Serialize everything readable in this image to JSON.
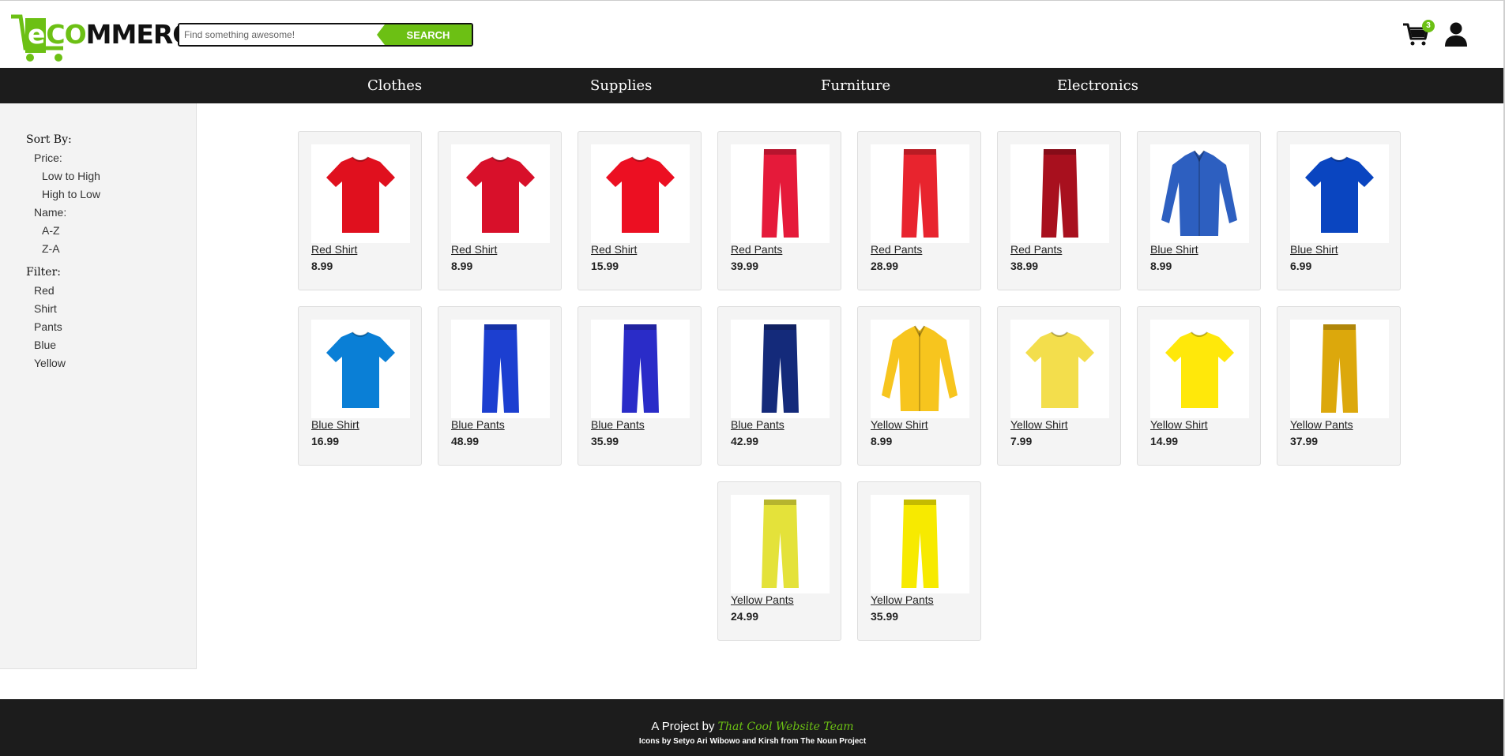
{
  "logo": {
    "part_e": "e",
    "part_co": "CO",
    "part_rest": "MMERCE"
  },
  "search": {
    "placeholder": "Find something awesome!",
    "button_label": "SEARCH"
  },
  "cart": {
    "count": "3"
  },
  "nav": {
    "items": [
      "Clothes",
      "Supplies",
      "Furniture",
      "Electronics"
    ]
  },
  "sidebar": {
    "sort_heading": "Sort By:",
    "price_label": "Price:",
    "price_low_high": "Low to High",
    "price_high_low": "High to Low",
    "name_label": "Name:",
    "name_az": "A-Z",
    "name_za": "Z-A",
    "filter_heading": "Filter:",
    "filters": [
      "Red",
      "Shirt",
      "Pants",
      "Blue",
      "Yellow"
    ]
  },
  "products": [
    {
      "name": "Red Shirt",
      "price": "8.99",
      "kind": "tshirt",
      "color": "#e0101e"
    },
    {
      "name": "Red Shirt",
      "price": "8.99",
      "kind": "tshirt",
      "color": "#d8102a"
    },
    {
      "name": "Red Shirt",
      "price": "15.99",
      "kind": "tshirt",
      "color": "#ec0f22"
    },
    {
      "name": "Red Pants",
      "price": "39.99",
      "kind": "pants",
      "color": "#e51a3a"
    },
    {
      "name": "Red Pants",
      "price": "28.99",
      "kind": "pants",
      "color": "#e8242e"
    },
    {
      "name": "Red Pants",
      "price": "38.99",
      "kind": "pants",
      "color": "#a8101e"
    },
    {
      "name": "Blue Shirt",
      "price": "8.99",
      "kind": "dress",
      "color": "#2d5fc0"
    },
    {
      "name": "Blue Shirt",
      "price": "6.99",
      "kind": "tshirt",
      "color": "#0a45c0"
    },
    {
      "name": "Blue Shirt",
      "price": "16.99",
      "kind": "tshirt",
      "color": "#0a7fd6"
    },
    {
      "name": "Blue Pants",
      "price": "48.99",
      "kind": "pants",
      "color": "#1c3fd0"
    },
    {
      "name": "Blue Pants",
      "price": "35.99",
      "kind": "pants",
      "color": "#2a2cc8"
    },
    {
      "name": "Blue Pants",
      "price": "42.99",
      "kind": "pants",
      "color": "#142a7a"
    },
    {
      "name": "Yellow Shirt",
      "price": "8.99",
      "kind": "dress",
      "color": "#f7c51e"
    },
    {
      "name": "Yellow Shirt",
      "price": "7.99",
      "kind": "tshirt",
      "color": "#f3de4c"
    },
    {
      "name": "Yellow Shirt",
      "price": "14.99",
      "kind": "tshirt",
      "color": "#ffe80a"
    },
    {
      "name": "Yellow Pants",
      "price": "37.99",
      "kind": "pants",
      "color": "#dca80c"
    },
    {
      "name": "Yellow Pants",
      "price": "24.99",
      "kind": "pants",
      "color": "#e4e23a"
    },
    {
      "name": "Yellow Pants",
      "price": "35.99",
      "kind": "pants",
      "color": "#f7ea00"
    }
  ],
  "footer": {
    "prefix": "A Project by ",
    "team": "That Cool Website Team",
    "credits": "Icons by Setyo Ari Wibowo and Kirsh from The Noun Project"
  },
  "colors": {
    "accent": "#6cc014",
    "nav_bg": "#1c1c1c"
  }
}
